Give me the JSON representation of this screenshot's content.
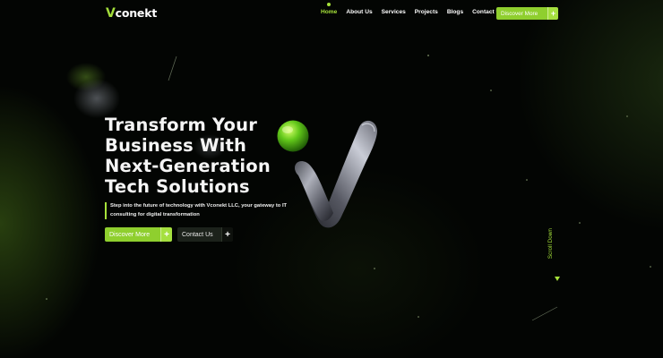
{
  "header": {
    "logo_text": "Vconekt",
    "nav": [
      {
        "label": "Home",
        "active": true
      },
      {
        "label": "About Us",
        "active": false
      },
      {
        "label": "Services",
        "active": false
      },
      {
        "label": "Projects",
        "active": false
      },
      {
        "label": "Blogs",
        "active": false
      },
      {
        "label": "Contact Us",
        "active": false
      }
    ],
    "cta_label": "Discover More",
    "cta_icon": "plus-icon"
  },
  "hero": {
    "title_lines": [
      "Transform Your",
      "Business With",
      "Next-Generation",
      "Tech Solutions"
    ],
    "description": "Step into the future of technology with Vconekt LLC, your gateway to IT consulting for digital transformation",
    "primary_button": "Discover More",
    "secondary_button": "Contact Us",
    "button_icon": "plus-icon"
  },
  "scroll": {
    "label": "Scroll Down",
    "icon": "arrow-down-icon"
  },
  "colors": {
    "accent": "#a6e23a",
    "accent_dark": "#8fcf2e",
    "background": "#030503",
    "dark_button": "#1c221b"
  }
}
